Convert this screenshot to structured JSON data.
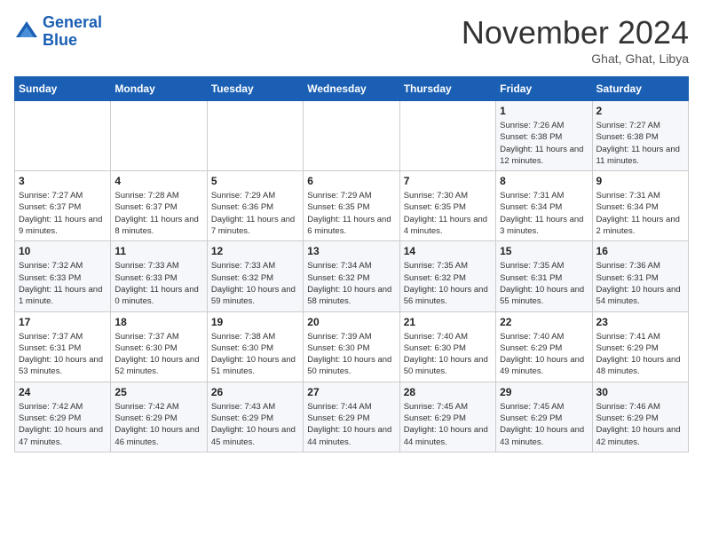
{
  "header": {
    "logo_line1": "General",
    "logo_line2": "Blue",
    "month": "November 2024",
    "location": "Ghat, Ghat, Libya"
  },
  "days_of_week": [
    "Sunday",
    "Monday",
    "Tuesday",
    "Wednesday",
    "Thursday",
    "Friday",
    "Saturday"
  ],
  "weeks": [
    [
      {
        "day": "",
        "info": ""
      },
      {
        "day": "",
        "info": ""
      },
      {
        "day": "",
        "info": ""
      },
      {
        "day": "",
        "info": ""
      },
      {
        "day": "",
        "info": ""
      },
      {
        "day": "1",
        "info": "Sunrise: 7:26 AM\nSunset: 6:38 PM\nDaylight: 11 hours and 12 minutes."
      },
      {
        "day": "2",
        "info": "Sunrise: 7:27 AM\nSunset: 6:38 PM\nDaylight: 11 hours and 11 minutes."
      }
    ],
    [
      {
        "day": "3",
        "info": "Sunrise: 7:27 AM\nSunset: 6:37 PM\nDaylight: 11 hours and 9 minutes."
      },
      {
        "day": "4",
        "info": "Sunrise: 7:28 AM\nSunset: 6:37 PM\nDaylight: 11 hours and 8 minutes."
      },
      {
        "day": "5",
        "info": "Sunrise: 7:29 AM\nSunset: 6:36 PM\nDaylight: 11 hours and 7 minutes."
      },
      {
        "day": "6",
        "info": "Sunrise: 7:29 AM\nSunset: 6:35 PM\nDaylight: 11 hours and 6 minutes."
      },
      {
        "day": "7",
        "info": "Sunrise: 7:30 AM\nSunset: 6:35 PM\nDaylight: 11 hours and 4 minutes."
      },
      {
        "day": "8",
        "info": "Sunrise: 7:31 AM\nSunset: 6:34 PM\nDaylight: 11 hours and 3 minutes."
      },
      {
        "day": "9",
        "info": "Sunrise: 7:31 AM\nSunset: 6:34 PM\nDaylight: 11 hours and 2 minutes."
      }
    ],
    [
      {
        "day": "10",
        "info": "Sunrise: 7:32 AM\nSunset: 6:33 PM\nDaylight: 11 hours and 1 minute."
      },
      {
        "day": "11",
        "info": "Sunrise: 7:33 AM\nSunset: 6:33 PM\nDaylight: 11 hours and 0 minutes."
      },
      {
        "day": "12",
        "info": "Sunrise: 7:33 AM\nSunset: 6:32 PM\nDaylight: 10 hours and 59 minutes."
      },
      {
        "day": "13",
        "info": "Sunrise: 7:34 AM\nSunset: 6:32 PM\nDaylight: 10 hours and 58 minutes."
      },
      {
        "day": "14",
        "info": "Sunrise: 7:35 AM\nSunset: 6:32 PM\nDaylight: 10 hours and 56 minutes."
      },
      {
        "day": "15",
        "info": "Sunrise: 7:35 AM\nSunset: 6:31 PM\nDaylight: 10 hours and 55 minutes."
      },
      {
        "day": "16",
        "info": "Sunrise: 7:36 AM\nSunset: 6:31 PM\nDaylight: 10 hours and 54 minutes."
      }
    ],
    [
      {
        "day": "17",
        "info": "Sunrise: 7:37 AM\nSunset: 6:31 PM\nDaylight: 10 hours and 53 minutes."
      },
      {
        "day": "18",
        "info": "Sunrise: 7:37 AM\nSunset: 6:30 PM\nDaylight: 10 hours and 52 minutes."
      },
      {
        "day": "19",
        "info": "Sunrise: 7:38 AM\nSunset: 6:30 PM\nDaylight: 10 hours and 51 minutes."
      },
      {
        "day": "20",
        "info": "Sunrise: 7:39 AM\nSunset: 6:30 PM\nDaylight: 10 hours and 50 minutes."
      },
      {
        "day": "21",
        "info": "Sunrise: 7:40 AM\nSunset: 6:30 PM\nDaylight: 10 hours and 50 minutes."
      },
      {
        "day": "22",
        "info": "Sunrise: 7:40 AM\nSunset: 6:29 PM\nDaylight: 10 hours and 49 minutes."
      },
      {
        "day": "23",
        "info": "Sunrise: 7:41 AM\nSunset: 6:29 PM\nDaylight: 10 hours and 48 minutes."
      }
    ],
    [
      {
        "day": "24",
        "info": "Sunrise: 7:42 AM\nSunset: 6:29 PM\nDaylight: 10 hours and 47 minutes."
      },
      {
        "day": "25",
        "info": "Sunrise: 7:42 AM\nSunset: 6:29 PM\nDaylight: 10 hours and 46 minutes."
      },
      {
        "day": "26",
        "info": "Sunrise: 7:43 AM\nSunset: 6:29 PM\nDaylight: 10 hours and 45 minutes."
      },
      {
        "day": "27",
        "info": "Sunrise: 7:44 AM\nSunset: 6:29 PM\nDaylight: 10 hours and 44 minutes."
      },
      {
        "day": "28",
        "info": "Sunrise: 7:45 AM\nSunset: 6:29 PM\nDaylight: 10 hours and 44 minutes."
      },
      {
        "day": "29",
        "info": "Sunrise: 7:45 AM\nSunset: 6:29 PM\nDaylight: 10 hours and 43 minutes."
      },
      {
        "day": "30",
        "info": "Sunrise: 7:46 AM\nSunset: 6:29 PM\nDaylight: 10 hours and 42 minutes."
      }
    ]
  ]
}
